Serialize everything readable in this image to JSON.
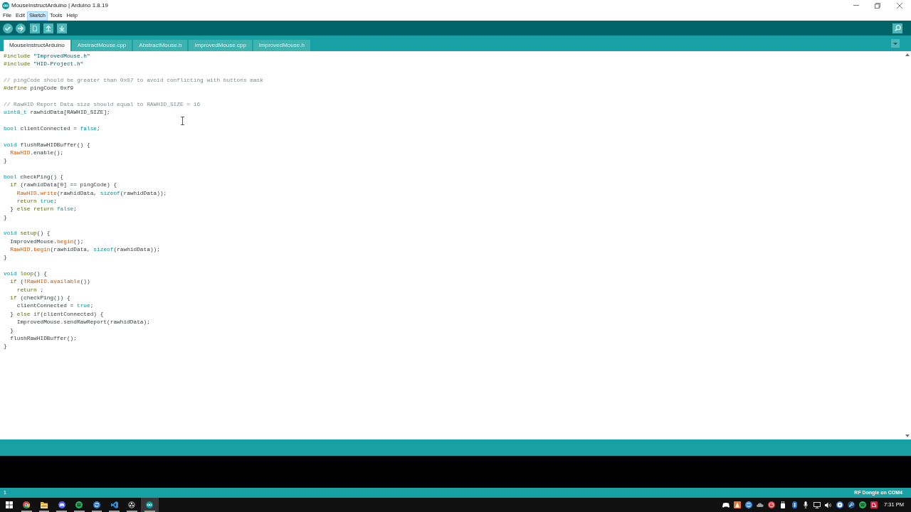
{
  "window": {
    "title": "MouseInstructArduino | Arduino 1.8.19"
  },
  "menu": [
    {
      "label": "File",
      "selected": false
    },
    {
      "label": "Edit",
      "selected": false
    },
    {
      "label": "Sketch",
      "selected": true
    },
    {
      "label": "Tools",
      "selected": false
    },
    {
      "label": "Help",
      "selected": false
    }
  ],
  "tabs": [
    {
      "label": "MouseInstructArduino",
      "selected": true
    },
    {
      "label": "AbstractMouse.cpp",
      "selected": false
    },
    {
      "label": "AbstractMouse.h",
      "selected": false
    },
    {
      "label": "ImprovedMouse.cpp",
      "selected": false
    },
    {
      "label": "ImprovedMouse.h",
      "selected": false
    }
  ],
  "editor": {
    "blocks": [
      {
        "lines": [
          [
            {
              "kind": "preprocessor",
              "text": "#include"
            },
            {
              "kind": "string",
              "text": " \"ImprovedMouse.h\""
            }
          ],
          [
            {
              "kind": "preprocessor",
              "text": "#include"
            },
            {
              "kind": "string",
              "text": " \"HID-Project.h\""
            }
          ]
        ]
      },
      {
        "lines": [
          [
            {
              "kind": "comment",
              "text": "// pingCode should be greater than 0x07 to avoid conflicting with buttons mask"
            }
          ],
          [
            {
              "kind": "preprocessor",
              "text": "#define"
            },
            {
              "kind": "plain",
              "text": " pingCode 0xf9"
            }
          ]
        ]
      },
      {
        "lines": [
          [
            {
              "kind": "comment",
              "text": "// RawHID Report Data size should equal to RAWHID_SIZE = 16"
            }
          ],
          [
            {
              "kind": "type",
              "text": "uint8_t"
            },
            {
              "kind": "plain",
              "text": " rawhidData[RAWHID_SIZE];"
            }
          ]
        ]
      },
      {
        "lines": [
          [
            {
              "kind": "type",
              "text": "bool"
            },
            {
              "kind": "plain",
              "text": " clientConnected = "
            },
            {
              "kind": "literal",
              "text": "false"
            },
            {
              "kind": "plain",
              "text": ";"
            }
          ]
        ]
      },
      {
        "lines": [
          [
            {
              "kind": "type",
              "text": "void"
            },
            {
              "kind": "plain",
              "text": " flushRawHIDBuffer() {"
            }
          ],
          [
            {
              "kind": "function",
              "text": "  RawHID"
            },
            {
              "kind": "plain",
              "text": ".enable();"
            }
          ],
          [
            {
              "kind": "plain",
              "text": "}"
            }
          ]
        ]
      },
      {
        "lines": [
          [
            {
              "kind": "type",
              "text": "bool"
            },
            {
              "kind": "plain",
              "text": " checkPing() {"
            }
          ],
          [
            {
              "kind": "control",
              "text": "  if"
            },
            {
              "kind": "plain",
              "text": " (rawhidData[0] == pingCode) {"
            }
          ],
          [
            {
              "kind": "function",
              "text": "    RawHID"
            },
            {
              "kind": "plain",
              "text": "."
            },
            {
              "kind": "function",
              "text": "write"
            },
            {
              "kind": "plain",
              "text": "(rawhidData, "
            },
            {
              "kind": "literal",
              "text": "sizeof"
            },
            {
              "kind": "plain",
              "text": "(rawhidData));"
            }
          ],
          [
            {
              "kind": "control",
              "text": "    return"
            },
            {
              "kind": "literal",
              "text": " true"
            },
            {
              "kind": "plain",
              "text": ";"
            }
          ],
          [
            {
              "kind": "plain",
              "text": "  } "
            },
            {
              "kind": "control",
              "text": "else"
            },
            {
              "kind": "control",
              "text": " return"
            },
            {
              "kind": "literal",
              "text": " false"
            },
            {
              "kind": "plain",
              "text": ";"
            }
          ],
          [
            {
              "kind": "plain",
              "text": "}"
            }
          ]
        ]
      },
      {
        "lines": [
          [
            {
              "kind": "type",
              "text": "void"
            },
            {
              "kind": "control",
              "text": " setup"
            },
            {
              "kind": "plain",
              "text": "() {"
            }
          ],
          [
            {
              "kind": "plain",
              "text": "  ImprovedMouse."
            },
            {
              "kind": "function",
              "text": "begin"
            },
            {
              "kind": "plain",
              "text": "();"
            }
          ],
          [
            {
              "kind": "function",
              "text": "  RawHID"
            },
            {
              "kind": "plain",
              "text": "."
            },
            {
              "kind": "function",
              "text": "begin"
            },
            {
              "kind": "plain",
              "text": "(rawhidData, "
            },
            {
              "kind": "literal",
              "text": "sizeof"
            },
            {
              "kind": "plain",
              "text": "(rawhidData));"
            }
          ],
          [
            {
              "kind": "plain",
              "text": "}"
            }
          ]
        ]
      },
      {
        "lines": [
          [
            {
              "kind": "type",
              "text": "void"
            },
            {
              "kind": "control",
              "text": " loop"
            },
            {
              "kind": "plain",
              "text": "() {"
            }
          ],
          [
            {
              "kind": "control",
              "text": "  if"
            },
            {
              "kind": "plain",
              "text": " (!"
            },
            {
              "kind": "function",
              "text": "RawHID"
            },
            {
              "kind": "plain",
              "text": "."
            },
            {
              "kind": "function",
              "text": "available"
            },
            {
              "kind": "plain",
              "text": "())"
            }
          ],
          [
            {
              "kind": "control",
              "text": "    return"
            },
            {
              "kind": "plain",
              "text": " ;"
            }
          ],
          [
            {
              "kind": "control",
              "text": "  if"
            },
            {
              "kind": "plain",
              "text": " (checkPing()) {"
            }
          ],
          [
            {
              "kind": "plain",
              "text": "    clientConnected = "
            },
            {
              "kind": "literal",
              "text": "true"
            },
            {
              "kind": "plain",
              "text": ";"
            }
          ],
          [
            {
              "kind": "plain",
              "text": "  } "
            },
            {
              "kind": "control",
              "text": "else"
            },
            {
              "kind": "control",
              "text": " if"
            },
            {
              "kind": "plain",
              "text": "(clientConnected) {"
            }
          ],
          [
            {
              "kind": "plain",
              "text": "    ImprovedMouse.sendRawReport(rawhidData);"
            }
          ],
          [
            {
              "kind": "plain",
              "text": "  }"
            }
          ],
          [
            {
              "kind": "plain",
              "text": "  flushRawHIDBuffer();"
            }
          ],
          [
            {
              "kind": "plain",
              "text": "}"
            }
          ]
        ]
      }
    ]
  },
  "status_bar": {
    "line": "1",
    "board": "RF Dongle on COM4"
  },
  "taskbar": {
    "apps": [
      {
        "kind": "ring",
        "open": true,
        "selected": false
      },
      {
        "kind": "folder",
        "open": true,
        "selected": false
      },
      {
        "kind": "gamepad",
        "open": true,
        "selected": false
      },
      {
        "kind": "waves",
        "open": true,
        "selected": false
      },
      {
        "kind": "swirl",
        "open": true,
        "selected": false
      },
      {
        "kind": "ribbon",
        "open": true,
        "selected": false
      },
      {
        "kind": "aperture",
        "open": true,
        "selected": false
      },
      {
        "kind": "infinity",
        "open": true,
        "selected": true
      }
    ],
    "clock": "7:31 PM"
  }
}
